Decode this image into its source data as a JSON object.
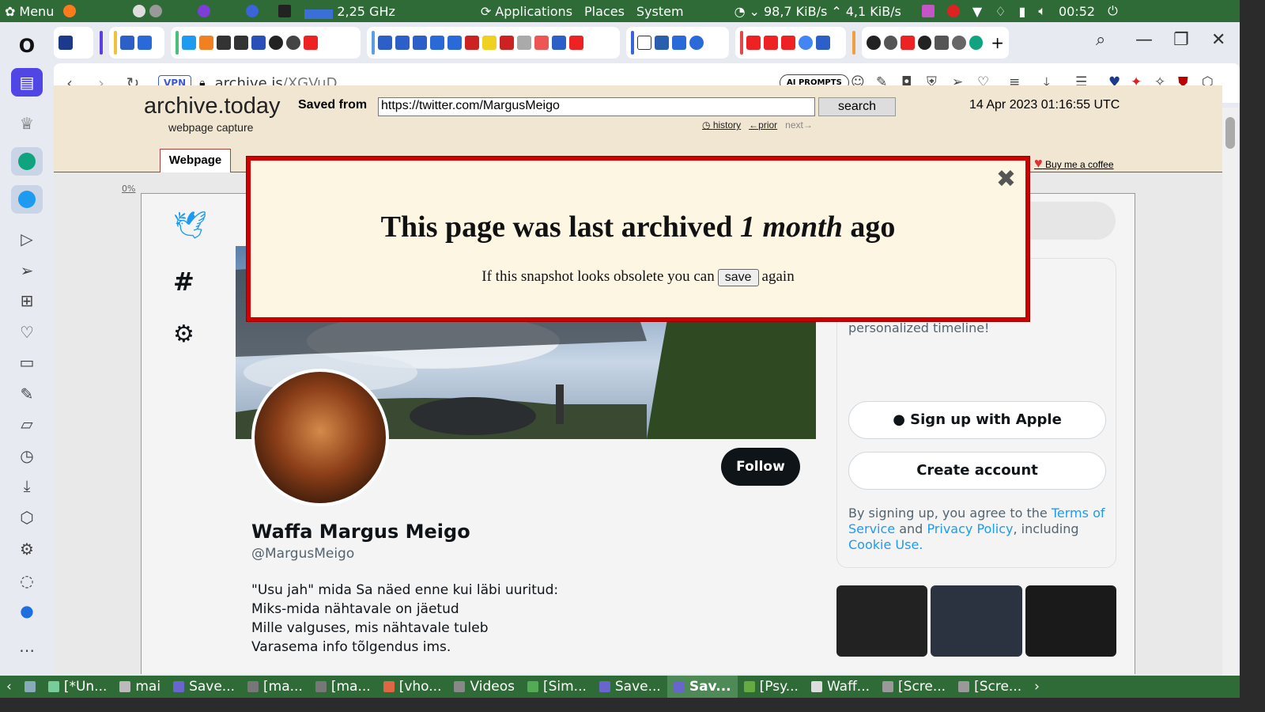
{
  "system_panel": {
    "menu_label": "Menu",
    "cpu_freq": "2,25 GHz",
    "apps": [
      "Applications",
      "Places",
      "System"
    ],
    "net_down": "98,7 KiB/s",
    "net_up": "4,1 KiB/s",
    "clock": "00:52"
  },
  "browser": {
    "vpn_label": "VPN",
    "url_host": "archive.is",
    "url_path": "/XGVuD",
    "ai_prompts_label": "AI PROMPTS"
  },
  "archive": {
    "logo": "archive.today",
    "logo_sub": "webpage capture",
    "saved_from_label": "Saved from",
    "saved_url": "https://twitter.com/MargusMeigo",
    "search_label": "search",
    "timestamp": "14 Apr 2023 01:16:55 UTC",
    "history_label": "history",
    "prior_label": "←prior",
    "next_label": "next→",
    "tab_label": "Webpage",
    "coffee_label": "Buy me a coffee",
    "zoom": "0%"
  },
  "popup": {
    "title_pre": "This page was last archived",
    "title_em": "1 month",
    "title_post": "ago",
    "line_pre": "If this snapshot looks obsolete you can",
    "save_label": "save",
    "line_post": "again",
    "close": "✖"
  },
  "twitter": {
    "follow_label": "Follow",
    "display_name": "Waffa Margus Meigo",
    "handle": "@MargusMeigo",
    "bio": [
      "\"Usu jah\" mida Sa näed enne kui läbi uuritud:",
      "Miks-mida nähtavale on jäetud",
      "Mille valguses, mis nähtavale tuleb",
      "Varasema info tõlgendus ims."
    ],
    "signup_text": "Sign up now to get your own personalized timeline!",
    "apple_label": "Sign up with Apple",
    "create_label": "Create account",
    "terms_pre": "By signing up, you agree to the",
    "terms_link": "Terms of Service",
    "and_label": "and",
    "privacy_link": "Privacy Policy",
    "including_label": ", including",
    "cookie_link": "Cookie Use."
  },
  "taskbar": {
    "items": [
      "[*Un...",
      "mai",
      "Save...",
      "[ma...",
      "[ma...",
      "[vho...",
      "Videos",
      "[Sim...",
      "Save...",
      "Sav...",
      "[Psy...",
      "Waff...",
      "[Scre...",
      "[Scre..."
    ]
  },
  "colors": {
    "panel_green": "#2e6b36",
    "archive_beige": "#f0e6d2",
    "popup_red": "#cc0000",
    "twitter_blue": "#1d9bf0"
  }
}
